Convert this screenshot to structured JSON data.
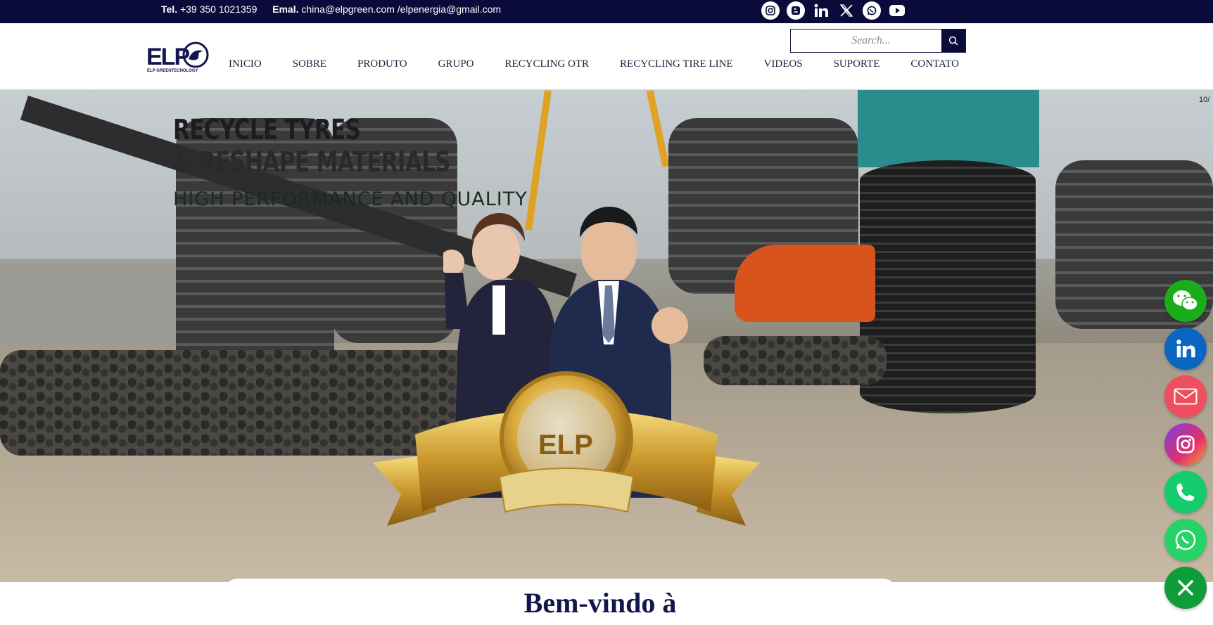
{
  "topbar": {
    "tel_label": "Tel.",
    "tel_value": "+39 350 1021359",
    "email_label": "Emal.",
    "email_value": "china@elpgreen.com /elpenergia@gmail.com",
    "social": [
      "instagram-icon",
      "blogger-icon",
      "linkedin-icon",
      "x-icon",
      "whatsapp-icon",
      "youtube-icon"
    ]
  },
  "header": {
    "logo_text": "ELP",
    "logo_tagline": "ELP GREENTECNOLOGY",
    "nav": [
      "INICIO",
      "SOBRE",
      "PRODUTO",
      "GRUPO",
      "RECYCLING OTR",
      "RECYCLING TIRE LINE",
      "VIDEOS",
      "SUPORTE",
      "CONTATO"
    ],
    "search_placeholder": "Search..."
  },
  "hero": {
    "title_line1": "RECYCLE TYRES",
    "title_line2": "& RESHAPE MATERIALS",
    "subtitle": "HIGH PERFORMANCE AND QUALITY",
    "slide_counter": "10/",
    "medal_text": "ELP"
  },
  "welcome": {
    "heading": "Bem-vindo à"
  },
  "floating_share": [
    "wechat-icon",
    "linkedin-icon",
    "email-icon",
    "instagram-icon",
    "phone-icon",
    "whatsapp-icon",
    "close-icon"
  ],
  "colors": {
    "navy": "#0b0b3b",
    "wechat": "#1aad19",
    "linkedin": "#0a66c2",
    "email": "#f04e5e",
    "phone": "#14cc6b",
    "whatsapp": "#25d366",
    "close": "#0f9d3a"
  }
}
